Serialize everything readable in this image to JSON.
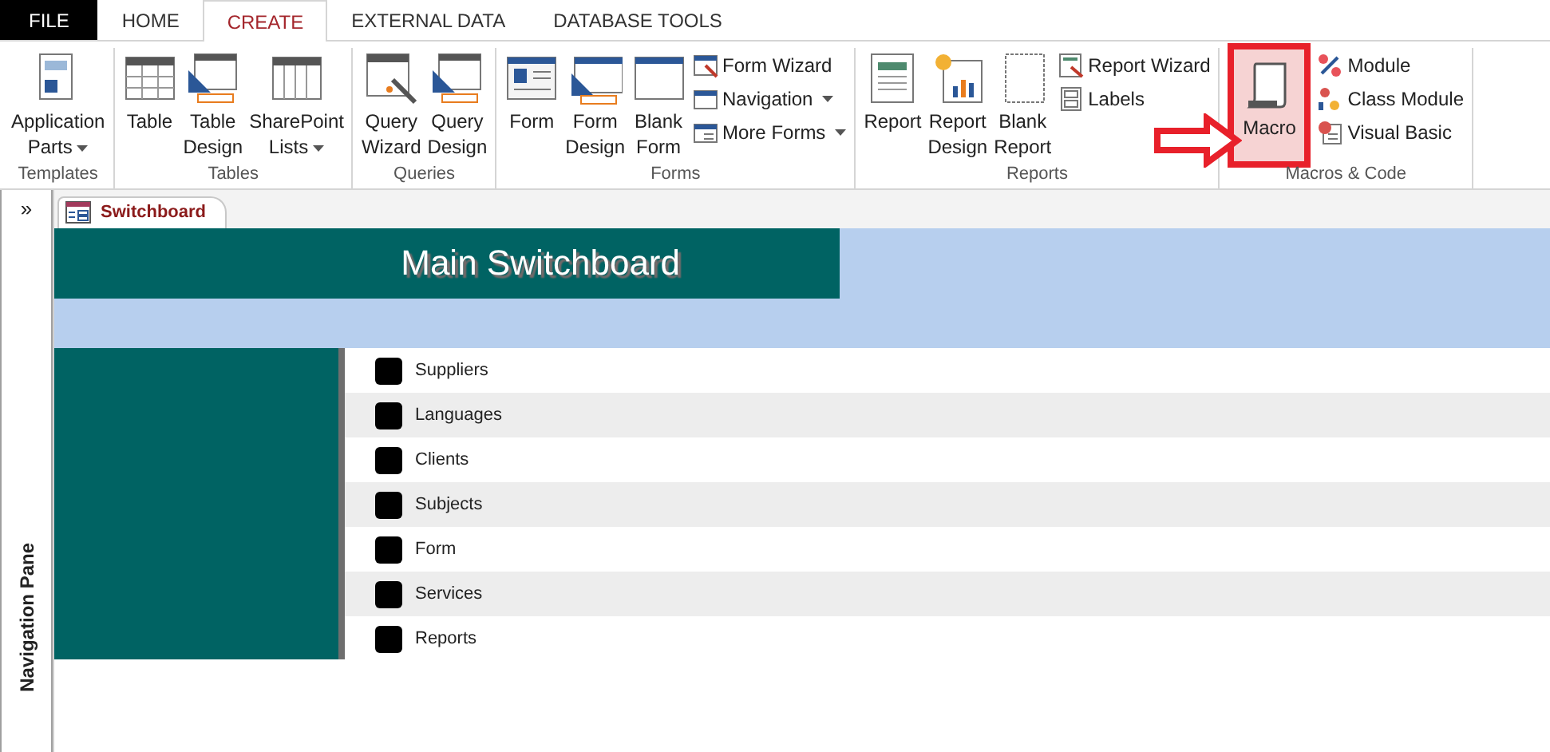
{
  "menu_tabs": [
    {
      "label": "FILE",
      "kind": "file",
      "selected": false
    },
    {
      "label": "HOME",
      "kind": "tab",
      "selected": false
    },
    {
      "label": "CREATE",
      "kind": "tab",
      "selected": true
    },
    {
      "label": "EXTERNAL DATA",
      "kind": "tab",
      "selected": false
    },
    {
      "label": "DATABASE TOOLS",
      "kind": "tab",
      "selected": false
    }
  ],
  "ribbon_groups": [
    {
      "label": "Templates",
      "items": [
        {
          "kind": "large",
          "label": "Application Parts",
          "dropdown": true,
          "highlighted": false
        }
      ]
    },
    {
      "label": "Tables",
      "items": [
        {
          "kind": "large",
          "label": "Table",
          "dropdown": false,
          "highlighted": false
        },
        {
          "kind": "large",
          "label": "Table Design",
          "dropdown": false,
          "highlighted": false
        },
        {
          "kind": "large",
          "label": "SharePoint Lists",
          "dropdown": true,
          "highlighted": false
        }
      ]
    },
    {
      "label": "Queries",
      "items": [
        {
          "kind": "large",
          "label": "Query Wizard",
          "dropdown": false,
          "highlighted": false
        },
        {
          "kind": "large",
          "label": "Query Design",
          "dropdown": false,
          "highlighted": false
        }
      ]
    },
    {
      "label": "Forms",
      "items": [
        {
          "kind": "large",
          "label": "Form",
          "dropdown": false,
          "highlighted": false
        },
        {
          "kind": "large",
          "label": "Form Design",
          "dropdown": false,
          "highlighted": false
        },
        {
          "kind": "large",
          "label": "Blank Form",
          "dropdown": false,
          "highlighted": false
        },
        {
          "kind": "small",
          "label": "Form Wizard",
          "dropdown": false,
          "highlighted": false
        },
        {
          "kind": "small",
          "label": "Navigation",
          "dropdown": true,
          "highlighted": false
        },
        {
          "kind": "small",
          "label": "More Forms",
          "dropdown": true,
          "highlighted": false
        }
      ]
    },
    {
      "label": "Reports",
      "items": [
        {
          "kind": "large",
          "label": "Report",
          "dropdown": false,
          "highlighted": false
        },
        {
          "kind": "large",
          "label": "Report Design",
          "dropdown": false,
          "highlighted": false
        },
        {
          "kind": "large",
          "label": "Blank Report",
          "dropdown": false,
          "highlighted": false
        },
        {
          "kind": "small",
          "label": "Report Wizard",
          "dropdown": false,
          "highlighted": false
        },
        {
          "kind": "small",
          "label": "Labels",
          "dropdown": false,
          "highlighted": false
        }
      ]
    },
    {
      "label": "Macros & Code",
      "items": [
        {
          "kind": "large",
          "label": "Macro",
          "dropdown": false,
          "highlighted": true
        },
        {
          "kind": "small",
          "label": "Module",
          "dropdown": false,
          "highlighted": false
        },
        {
          "kind": "small",
          "label": "Class Module",
          "dropdown": false,
          "highlighted": false
        },
        {
          "kind": "small",
          "label": "Visual Basic",
          "dropdown": false,
          "highlighted": false
        }
      ]
    }
  ],
  "navigation_pane": {
    "label": "Navigation Pane",
    "toggle": "»"
  },
  "document_tabs": [
    {
      "label": "Switchboard",
      "selected": true
    }
  ],
  "switchboard": {
    "title": "Main Switchboard",
    "items": [
      "Suppliers",
      "Languages",
      "Clients",
      "Subjects",
      "Form",
      "Services",
      "Reports"
    ]
  }
}
